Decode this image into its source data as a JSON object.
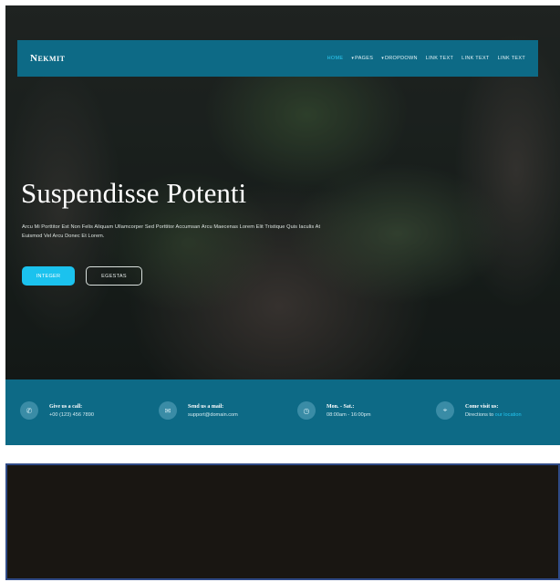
{
  "nav": {
    "brand": "Nekmit",
    "items": [
      {
        "label": "Home",
        "caret": false,
        "active": true
      },
      {
        "label": "Pages",
        "caret": true,
        "active": false
      },
      {
        "label": "Dropdown",
        "caret": true,
        "active": false
      },
      {
        "label": "Link Text",
        "caret": false,
        "active": false
      },
      {
        "label": "Link Text",
        "caret": false,
        "active": false
      },
      {
        "label": "Link Text",
        "caret": false,
        "active": false
      }
    ]
  },
  "hero": {
    "title": "Suspendisse Potenti",
    "description": "Arcu Mi Porttitor Est Non Felis Aliquam Ullamcorper Sed Porttitor Accumsan Arcu Maecenas Lorem Elit Tristique Quis Iaculis At Euismod Vel Arcu Donec Et Lorem.",
    "primary_button": "Integer",
    "secondary_button": "Egestas"
  },
  "info": [
    {
      "title": "Give us a call:",
      "sub": "+00 (123) 456 7890",
      "icon": "phone-icon",
      "glyph": "✆"
    },
    {
      "title": "Send us a mail:",
      "sub": "support@domain.com",
      "icon": "mail-icon",
      "glyph": "✉"
    },
    {
      "title": "Mon. - Sat.:",
      "sub": "08:00am - 16:00pm",
      "icon": "clock-icon",
      "glyph": "◷"
    },
    {
      "title": "Come visit us:",
      "sub": "Directions to",
      "link": "our location",
      "icon": "location-pin-icon",
      "glyph": "⌖"
    }
  ],
  "colors": {
    "primary": "#0d6a86",
    "accent": "#1bc2ee",
    "dark_panel": "#191612"
  }
}
